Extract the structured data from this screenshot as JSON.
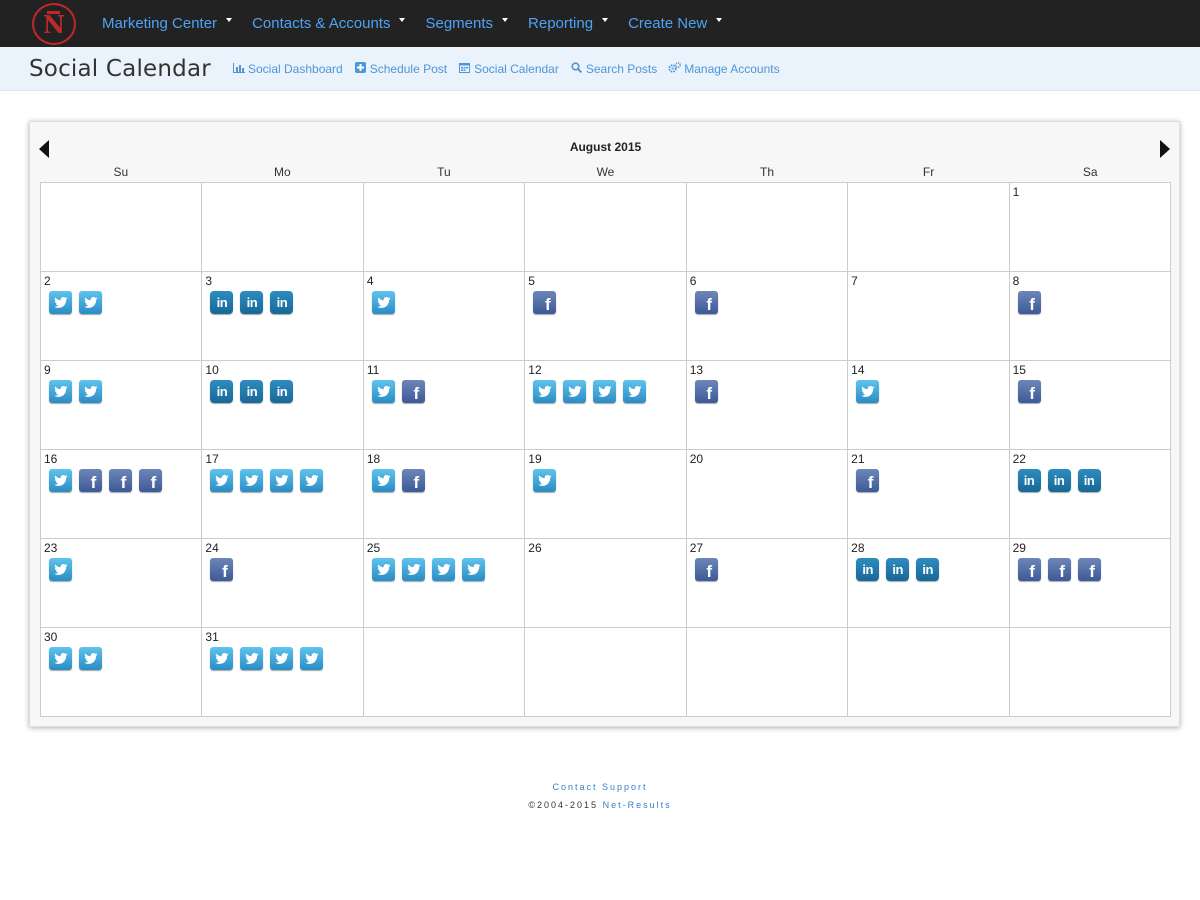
{
  "nav": {
    "logo_letter": "N",
    "items": [
      {
        "label": "Marketing Center"
      },
      {
        "label": "Contacts & Accounts"
      },
      {
        "label": "Segments"
      },
      {
        "label": "Reporting"
      },
      {
        "label": "Create New"
      }
    ]
  },
  "subheader": {
    "title": "Social Calendar",
    "links": [
      {
        "label": "Social Dashboard",
        "icon": "bar-chart-icon"
      },
      {
        "label": "Schedule Post",
        "icon": "plus-square-icon"
      },
      {
        "label": "Social Calendar",
        "icon": "calendar-icon"
      },
      {
        "label": "Search Posts",
        "icon": "search-icon"
      },
      {
        "label": "Manage Accounts",
        "icon": "gears-icon"
      }
    ]
  },
  "calendar": {
    "month_title": "August 2015",
    "weekdays": [
      "Su",
      "Mo",
      "Tu",
      "We",
      "Th",
      "Fr",
      "Sa"
    ],
    "first_weekday_index": 6,
    "days_in_month": 31,
    "posts": {
      "2": [
        "twitter",
        "twitter"
      ],
      "3": [
        "linkedin",
        "linkedin",
        "linkedin"
      ],
      "4": [
        "twitter"
      ],
      "5": [
        "facebook"
      ],
      "6": [
        "facebook"
      ],
      "8": [
        "facebook"
      ],
      "9": [
        "twitter",
        "twitter"
      ],
      "10": [
        "linkedin",
        "linkedin",
        "linkedin"
      ],
      "11": [
        "twitter",
        "facebook"
      ],
      "12": [
        "twitter",
        "twitter",
        "twitter",
        "twitter"
      ],
      "13": [
        "facebook"
      ],
      "14": [
        "twitter"
      ],
      "15": [
        "facebook"
      ],
      "16": [
        "twitter",
        "facebook",
        "facebook",
        "facebook"
      ],
      "17": [
        "twitter",
        "twitter",
        "twitter",
        "twitter"
      ],
      "18": [
        "twitter",
        "facebook"
      ],
      "19": [
        "twitter"
      ],
      "21": [
        "facebook"
      ],
      "22": [
        "linkedin",
        "linkedin",
        "linkedin"
      ],
      "23": [
        "twitter"
      ],
      "24": [
        "facebook"
      ],
      "25": [
        "twitter",
        "twitter",
        "twitter",
        "twitter"
      ],
      "27": [
        "facebook"
      ],
      "28": [
        "linkedin",
        "linkedin",
        "linkedin"
      ],
      "29": [
        "facebook",
        "facebook",
        "facebook"
      ],
      "30": [
        "twitter",
        "twitter"
      ],
      "31": [
        "twitter",
        "twitter",
        "twitter",
        "twitter"
      ]
    }
  },
  "footer": {
    "support_label": "Contact Support",
    "copyright": "©2004-2015",
    "brand": "Net-Results"
  },
  "colors": {
    "nav_bg": "#222222",
    "nav_link": "#4ea2f4",
    "logo_red": "#c0282a",
    "subheader_bg": "#eaf2fb",
    "twitter": "#3aa7dc",
    "facebook": "#4a66a0",
    "linkedin": "#1e77aa"
  }
}
